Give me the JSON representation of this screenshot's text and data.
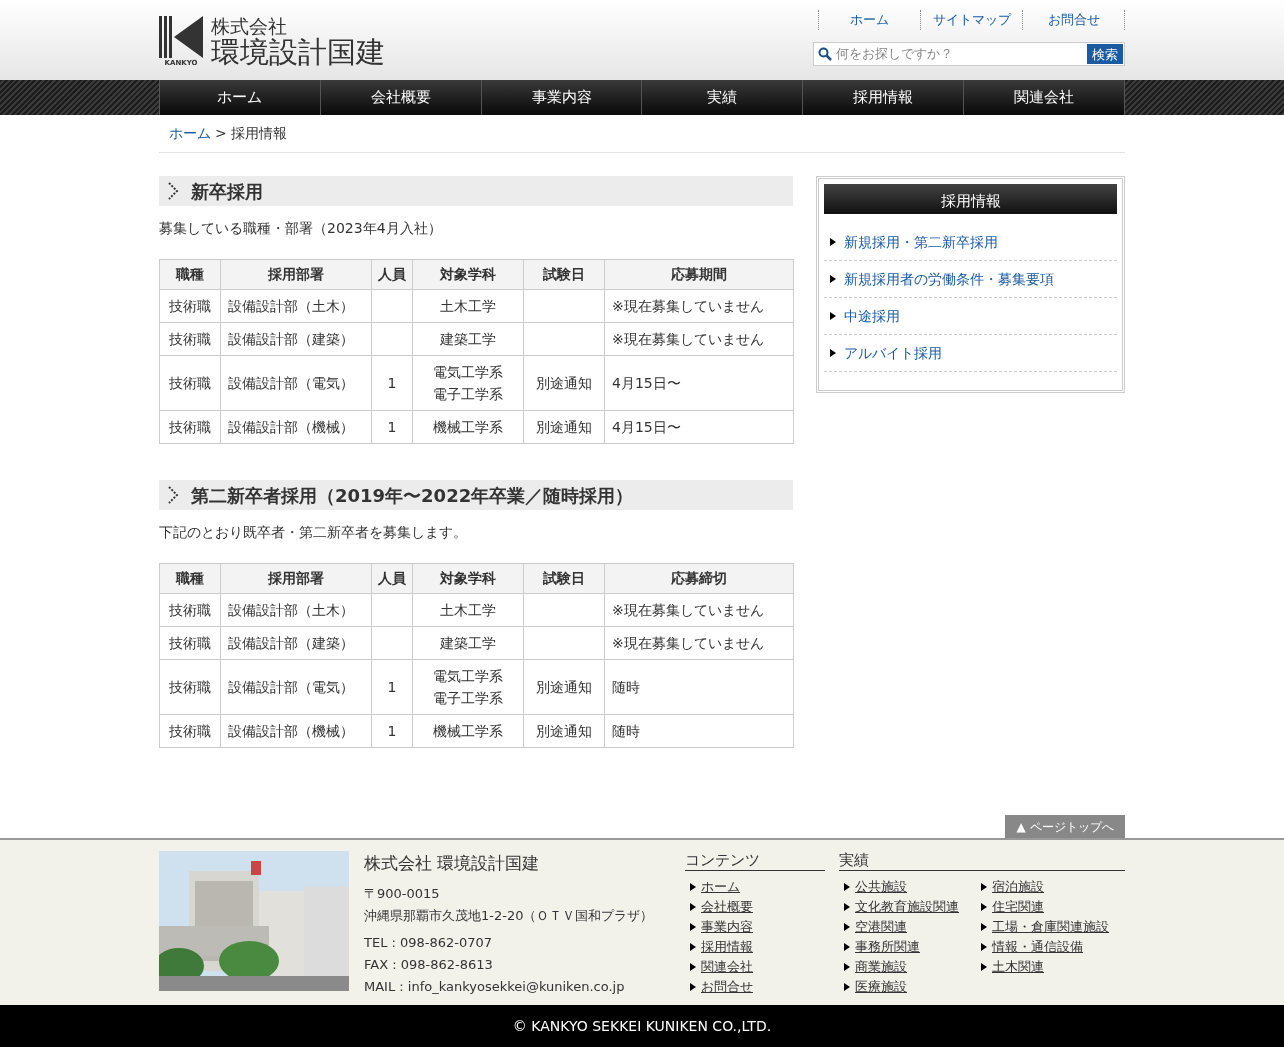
{
  "header": {
    "logo_mark": "KANKYO",
    "company_prefix": "株式会社",
    "company_name": "環境設計国建",
    "top_links": [
      "ホーム",
      "サイトマップ",
      "お問合せ"
    ],
    "search": {
      "placeholder": "何をお探しですか？",
      "button": "検索"
    }
  },
  "nav": [
    "ホーム",
    "会社概要",
    "事業内容",
    "実績",
    "採用情報",
    "関連会社"
  ],
  "breadcrumb": {
    "link": "ホーム",
    "separator": ">",
    "current": "採用情報"
  },
  "sections": [
    {
      "title": "新卒採用",
      "intro": "募集している職種・部署（2023年4月入社）",
      "columns": [
        "職種",
        "採用部署",
        "人員",
        "対象学科",
        "試験日",
        "応募期間"
      ],
      "rows": [
        [
          "技術職",
          "設備設計部（土木）",
          "",
          [
            "土木工学"
          ],
          "",
          "※現在募集していません"
        ],
        [
          "技術職",
          "設備設計部（建築）",
          "",
          [
            "建築工学"
          ],
          "",
          "※現在募集していません"
        ],
        [
          "技術職",
          "設備設計部（電気）",
          "1",
          [
            "電気工学系",
            "電子工学系"
          ],
          "別途通知",
          "4月15日〜"
        ],
        [
          "技術職",
          "設備設計部（機械）",
          "1",
          [
            "機械工学系"
          ],
          "別途通知",
          "4月15日〜"
        ]
      ]
    },
    {
      "title": "第二新卒者採用（2019年〜2022年卒業／随時採用）",
      "intro": "下記のとおり既卒者・第二新卒者を募集します。",
      "columns": [
        "職種",
        "採用部署",
        "人員",
        "対象学科",
        "試験日",
        "応募締切"
      ],
      "rows": [
        [
          "技術職",
          "設備設計部（土木）",
          "",
          [
            "土木工学"
          ],
          "",
          "※現在募集していません"
        ],
        [
          "技術職",
          "設備設計部（建築）",
          "",
          [
            "建築工学"
          ],
          "",
          "※現在募集していません"
        ],
        [
          "技術職",
          "設備設計部（電気）",
          "1",
          [
            "電気工学系",
            "電子工学系"
          ],
          "別途通知",
          "随時"
        ],
        [
          "技術職",
          "設備設計部（機械）",
          "1",
          [
            "機械工学系"
          ],
          "別途通知",
          "随時"
        ]
      ]
    }
  ],
  "sidebar": {
    "title": "採用情報",
    "items": [
      "新規採用・第二新卒採用",
      "新規採用者の労働条件・募集要項",
      "中途採用",
      "アルバイト採用"
    ]
  },
  "page_top": "▲ ページトップへ",
  "footer": {
    "photo": {
      "kind": "picture"
    },
    "company": "株式会社 環境設計国建",
    "address_lines": [
      "〒900-0015",
      "沖縄県那覇市久茂地1-2-20（ＯＴＶ国和プラザ）"
    ],
    "contact_lines": [
      "TEL : 098-862-0707",
      "FAX : 098-862-8613",
      "MAIL : info_kankyosekkei@kuniken.co.jp"
    ],
    "contents": {
      "title": "コンテンツ",
      "links": [
        "ホーム",
        "会社概要",
        "事業内容",
        "採用情報",
        "関連会社",
        "お問合せ"
      ]
    },
    "works": {
      "title": "実績",
      "links_col1": [
        "公共施設",
        "文化教育施設関連",
        "空港関連",
        "事務所関連",
        "商業施設",
        "医療施設"
      ],
      "links_col2": [
        "宿泊施設",
        "住宅関連",
        "工場・倉庫関連施設",
        "情報・通信設備",
        "土木関連"
      ]
    }
  },
  "copyright": "© KANKYO SEKKEI KUNIKEN CO.,LTD."
}
